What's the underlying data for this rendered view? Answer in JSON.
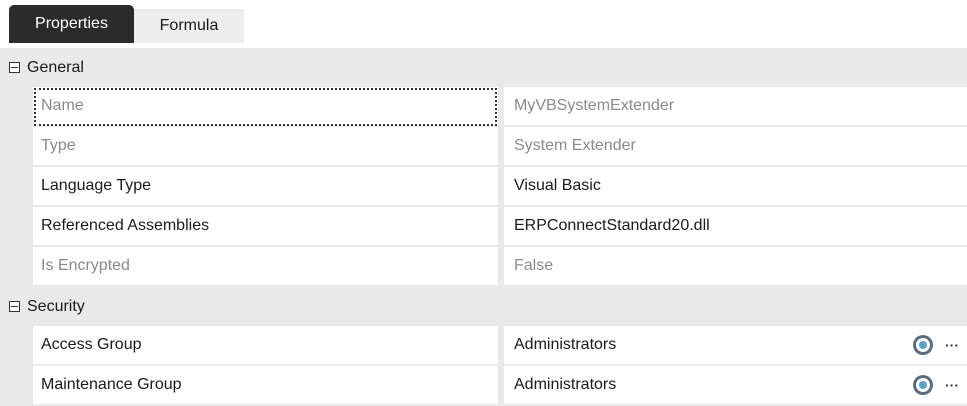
{
  "tabs": [
    {
      "label": "Properties",
      "active": true
    },
    {
      "label": "Formula",
      "active": false
    }
  ],
  "groups": [
    {
      "label": "General",
      "rows": [
        {
          "name": "Name",
          "value": "MyVBSystemExtender",
          "readonly": true
        },
        {
          "name": "Type",
          "value": "System Extender",
          "readonly": true
        },
        {
          "name": "Language Type",
          "value": "Visual Basic",
          "readonly": false
        },
        {
          "name": "Referenced Assemblies",
          "value": "ERPConnectStandard20.dll",
          "readonly": false
        },
        {
          "name": "Is Encrypted",
          "value": "False",
          "readonly": true
        }
      ]
    },
    {
      "label": "Security",
      "rows": [
        {
          "name": "Access Group",
          "value": "Administrators",
          "readonly": false
        },
        {
          "name": "Maintenance Group",
          "value": "Administrators",
          "readonly": false
        }
      ]
    }
  ],
  "buttons": {
    "ellipsis": "···"
  },
  "icons": {
    "group_toggle": "minus-box-icon",
    "group_picker": "globe-icon"
  },
  "colors": {
    "active_tab": "#2b2b2b",
    "grid_background": "#e9e9e9",
    "readonly_text": "#8a8a8a"
  }
}
